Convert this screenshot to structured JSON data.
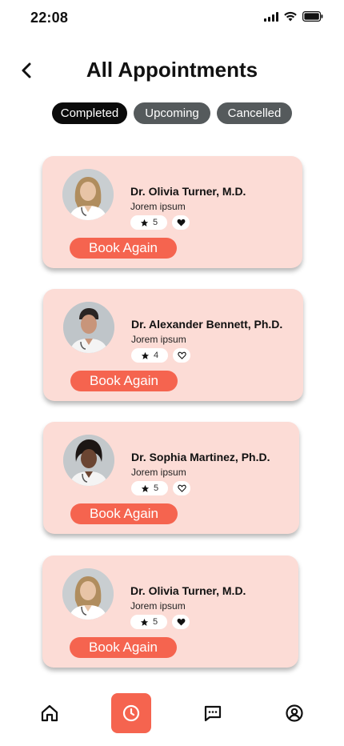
{
  "status": {
    "time": "22:08"
  },
  "header": {
    "title": "All Appointments"
  },
  "tabs": [
    {
      "label": "Completed",
      "active": true
    },
    {
      "label": "Upcoming",
      "active": false
    },
    {
      "label": "Cancelled",
      "active": false
    }
  ],
  "appointments": [
    {
      "name": "Dr. Olivia Turner, M.D.",
      "subtitle": "Jorem ipsum",
      "rating": "5",
      "favorite": true,
      "action": "Book Again"
    },
    {
      "name": "Dr. Alexander Bennett, Ph.D.",
      "subtitle": "Jorem ipsum",
      "rating": "4",
      "favorite": false,
      "action": "Book Again"
    },
    {
      "name": "Dr. Sophia Martinez, Ph.D.",
      "subtitle": "Jorem ipsum",
      "rating": "5",
      "favorite": false,
      "action": "Book Again"
    },
    {
      "name": "Dr. Olivia Turner, M.D.",
      "subtitle": "Jorem ipsum",
      "rating": "5",
      "favorite": true,
      "action": "Book Again"
    }
  ],
  "nav": {
    "items": [
      {
        "icon": "home-icon",
        "active": false
      },
      {
        "icon": "clock-icon",
        "active": true
      },
      {
        "icon": "chat-icon",
        "active": false
      },
      {
        "icon": "profile-icon",
        "active": false
      }
    ]
  },
  "colors": {
    "accent": "#f5644f",
    "card": "#fcdcd6",
    "tab_active": "#0b0b0b",
    "tab_inactive": "#555a5c"
  }
}
